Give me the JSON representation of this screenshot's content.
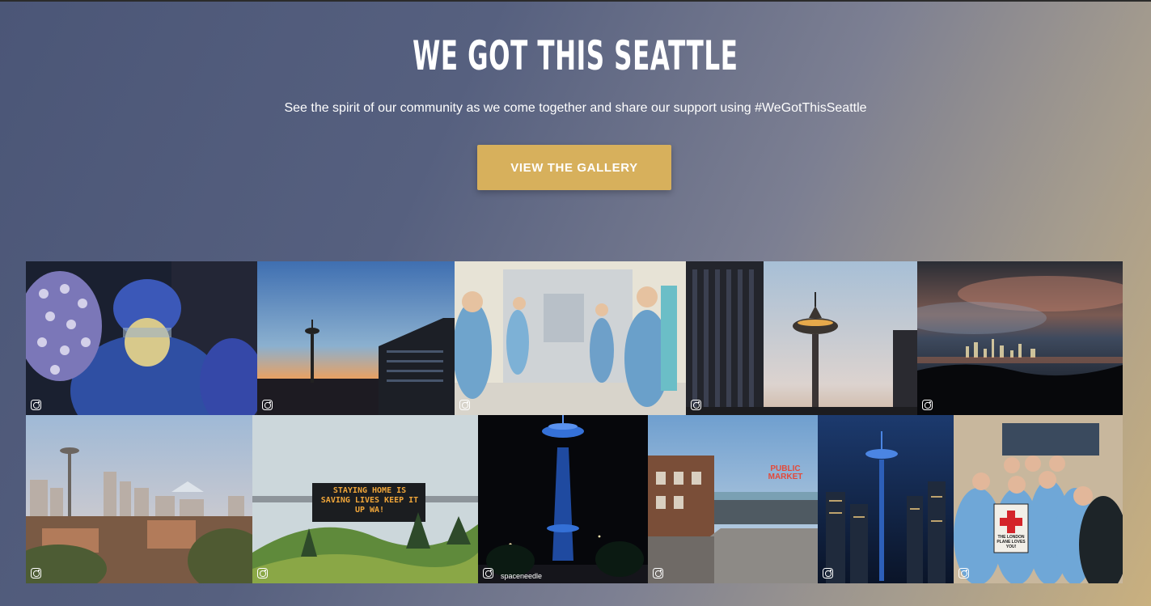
{
  "hero": {
    "title": "WE GOT THIS SEATTLE",
    "subtitle": "See the spirit of our community as we come together and share our support using #WeGotThisSeattle",
    "cta_label": "VIEW THE GALLERY"
  },
  "colors": {
    "accent": "#d7b05c",
    "text": "#ffffff"
  },
  "gallery": {
    "source_icon": "instagram-icon",
    "tiles": [
      {
        "name": "healthcare-worker-ppe"
      },
      {
        "name": "space-needle-sunset"
      },
      {
        "name": "nurses-hospital-corridor"
      },
      {
        "name": "space-needle-dusk"
      },
      {
        "name": "seattle-skyline-night-clouds"
      },
      {
        "name": "seattle-skyline-day"
      },
      {
        "name": "highway-sign",
        "sign_text": "STAYING HOME IS SAVING LIVES KEEP IT UP WA!"
      },
      {
        "name": "space-needle-blue-night",
        "handle": "spaceneedle"
      },
      {
        "name": "pike-place-market",
        "sign_text": "PUBLIC MARKET"
      },
      {
        "name": "space-needle-blue-skyline"
      },
      {
        "name": "nurses-group",
        "sign_text": "THE LONDON PLANE LOVES YOU!"
      }
    ]
  }
}
